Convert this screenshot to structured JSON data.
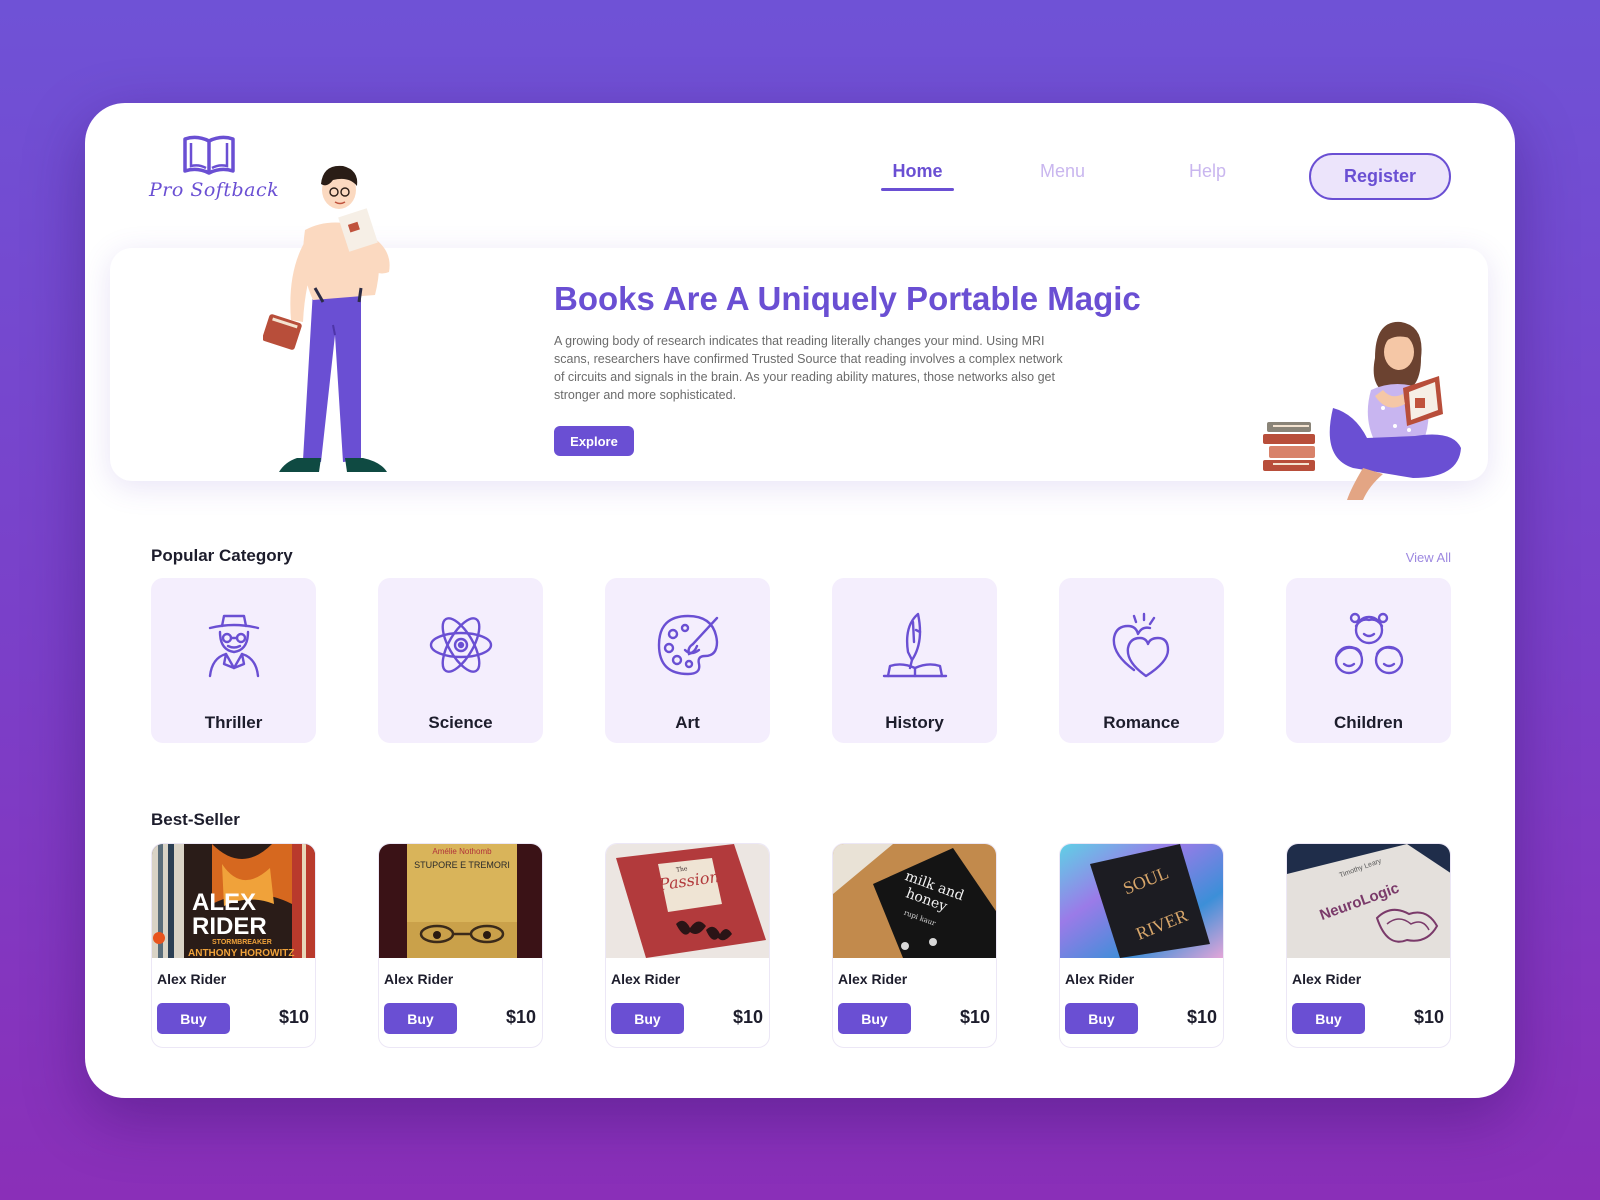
{
  "brand": {
    "name": "Pro Softback"
  },
  "nav": {
    "home": "Home",
    "menu": "Menu",
    "help": "Help",
    "register": "Register"
  },
  "hero": {
    "title": "Books Are A Uniquely Portable Magic",
    "body": "A growing body of research indicates that reading literally changes your mind. Using MRI scans, researchers have confirmed Trusted Source that reading involves a complex network of circuits and signals in the brain. As your reading ability matures, those networks also get stronger and more sophisticated.",
    "cta": "Explore"
  },
  "categories": {
    "title": "Popular Category",
    "view_all": "View All",
    "items": [
      {
        "label": "Thriller",
        "icon": "detective-icon"
      },
      {
        "label": "Science",
        "icon": "atom-icon"
      },
      {
        "label": "Art",
        "icon": "palette-icon"
      },
      {
        "label": "History",
        "icon": "quill-book-icon"
      },
      {
        "label": "Romance",
        "icon": "hearts-icon"
      },
      {
        "label": "Children",
        "icon": "children-icon"
      }
    ]
  },
  "bestseller": {
    "title": "Best-Seller",
    "items": [
      {
        "title": "Alex Rider",
        "buy": "Buy",
        "price": "$10",
        "cover_text": [
          "ALEX",
          "RIDER",
          "STORMBREAKER",
          "ANTHONY HOROWITZ"
        ]
      },
      {
        "title": "Alex Rider",
        "buy": "Buy",
        "price": "$10",
        "cover_text": [
          "Amélie Nothomb",
          "STUPORE E TREMORI"
        ]
      },
      {
        "title": "Alex Rider",
        "buy": "Buy",
        "price": "$10",
        "cover_text": [
          "The",
          "Passion"
        ]
      },
      {
        "title": "Alex Rider",
        "buy": "Buy",
        "price": "$10",
        "cover_text": [
          "milk and",
          "honey",
          "rupi kaur"
        ]
      },
      {
        "title": "Alex Rider",
        "buy": "Buy",
        "price": "$10",
        "cover_text": [
          "SOUL",
          "RIVER"
        ]
      },
      {
        "title": "Alex Rider",
        "buy": "Buy",
        "price": "$10",
        "cover_text": [
          "Timothy Leary",
          "NeuroLogic"
        ]
      }
    ]
  },
  "colors": {
    "accent": "#6a4fd3",
    "tile_bg": "#f4eefd",
    "background_top": "#6f52d6",
    "background_bottom": "#8a2fb8"
  }
}
